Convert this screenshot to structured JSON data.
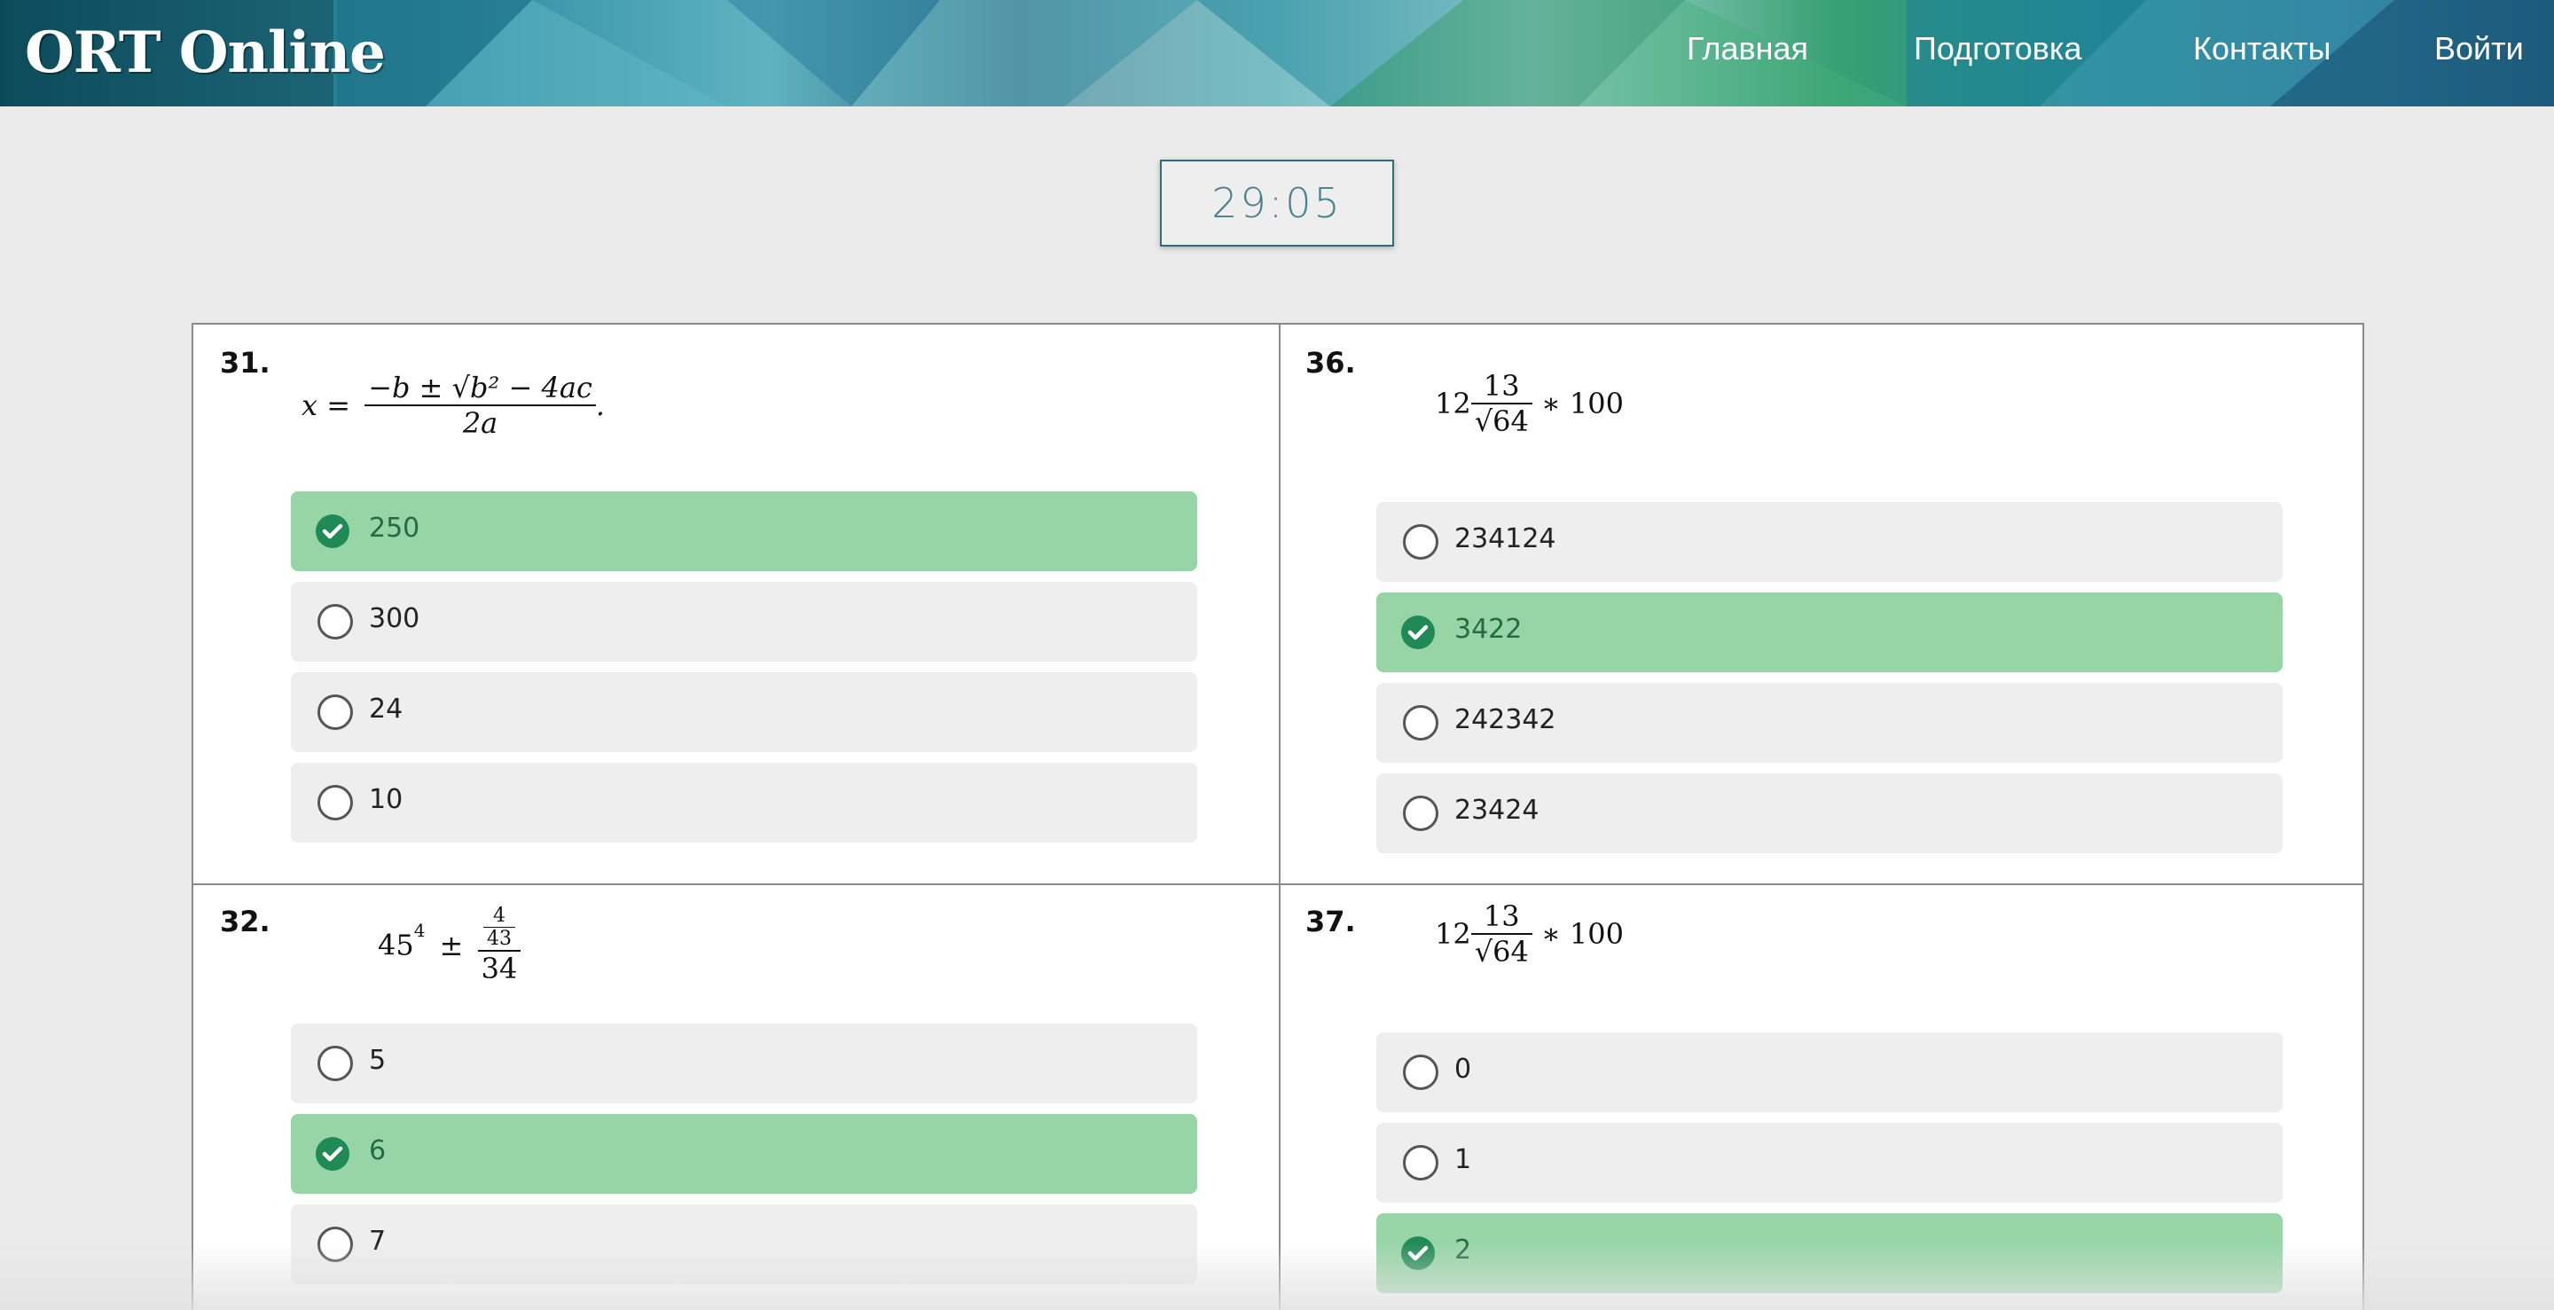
{
  "header": {
    "logo": "ORT Online",
    "nav": [
      "Главная",
      "Подготовка",
      "Контакты",
      "Войти"
    ]
  },
  "timer": "29:05",
  "colors": {
    "selected_bg": "#97d5a6",
    "option_bg": "#eeeeee",
    "check": "#1f8a55",
    "timer_border": "#2c6e7c"
  },
  "questions": [
    {
      "number": "31.",
      "formula": {
        "lhs": "x =",
        "num": "−b ± √b² − 4ac",
        "den": "2a",
        "tail": "."
      },
      "options": [
        {
          "label": "250",
          "selected": true
        },
        {
          "label": "300",
          "selected": false
        },
        {
          "label": "24",
          "selected": false
        },
        {
          "label": "10",
          "selected": false
        }
      ]
    },
    {
      "number": "36.",
      "formula": {
        "lead": "12",
        "num": "13",
        "den": "√64",
        "tail": "∗ 100"
      },
      "options": [
        {
          "label": "234124",
          "selected": false
        },
        {
          "label": "3422",
          "selected": true
        },
        {
          "label": "242342",
          "selected": false
        },
        {
          "label": "23424",
          "selected": false
        }
      ]
    },
    {
      "number": "32.",
      "formula": {
        "lead": "45",
        "sup": "4",
        "op": "±",
        "num_num": "4",
        "num_den": "43",
        "den": "34"
      },
      "options": [
        {
          "label": "5",
          "selected": false
        },
        {
          "label": "6",
          "selected": true
        },
        {
          "label": "7",
          "selected": false
        }
      ]
    },
    {
      "number": "37.",
      "formula": {
        "lead": "12",
        "num": "13",
        "den": "√64",
        "tail": "∗ 100"
      },
      "options": [
        {
          "label": "0",
          "selected": false
        },
        {
          "label": "1",
          "selected": false
        },
        {
          "label": "2",
          "selected": true
        }
      ]
    }
  ]
}
